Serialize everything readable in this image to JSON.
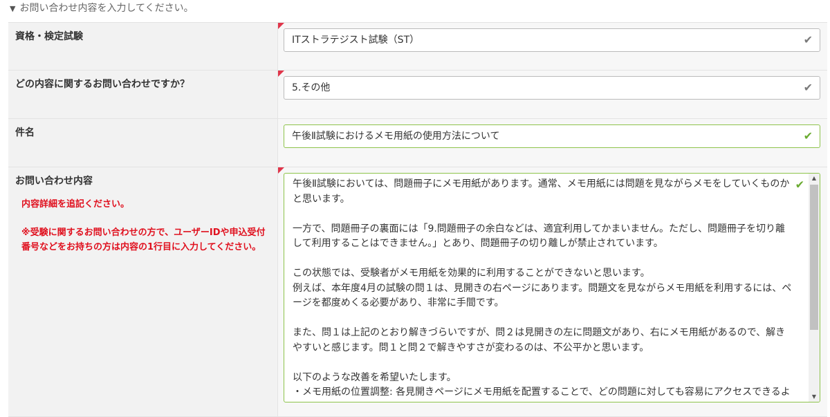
{
  "section": {
    "title": "お問い合わせ内容を入力してください。"
  },
  "fields": {
    "exam": {
      "label": "資格・検定試験",
      "value": "ITストラテジスト試験（ST）"
    },
    "topic": {
      "label": "どの内容に関するお問い合わせですか？",
      "value": "5.その他"
    },
    "subject": {
      "label": "件名",
      "value": "午後Ⅱ試験におけるメモ用紙の使用方法について"
    },
    "body": {
      "label": "お問い合わせ内容",
      "note1": "内容詳細を追記ください。",
      "note2": "※受験に関するお問い合わせの方で、ユーザーIDや申込受付番号などをお持ちの方は内容の1行目に入力してください。",
      "value": "午後Ⅱ試験においては、問題冊子にメモ用紙があります。通常、メモ用紙には問題を見ながらメモをしていくものかと思います。\n\n一方で、問題冊子の裏面には「9.問題冊子の余白などは、適宜利用してかまいません。ただし、問題冊子を切り離して利用することはできません。」とあり、問題冊子の切り離しが禁止されています。\n\nこの状態では、受験者がメモ用紙を効果的に利用することができないと思います。\n例えば、本年度4月の試験の問１は、見開きの右ページにあります。問題文を見ながらメモ用紙を利用するには、ページを都度めくる必要があり、非常に手間です。\n\nまた、問１は上記のとおり解きづらいですが、問２は見開きの左に問題文があり、右にメモ用紙があるので、解きやすいと感じます。問１と問２で解きやすさが変わるのは、不公平かと思います。\n\n以下のような改善を希望いたします。\n・メモ用紙の位置調整: 各見開きページにメモ用紙を配置することで、どの問題に対しても容易にアクセスできるようにする。"
    }
  },
  "icons": {
    "check": "checkmark-icon",
    "collapse": "triangle-down-icon"
  },
  "colors": {
    "required": "#e0354a",
    "valid": "#8dc34a",
    "note": "#e0101e"
  }
}
